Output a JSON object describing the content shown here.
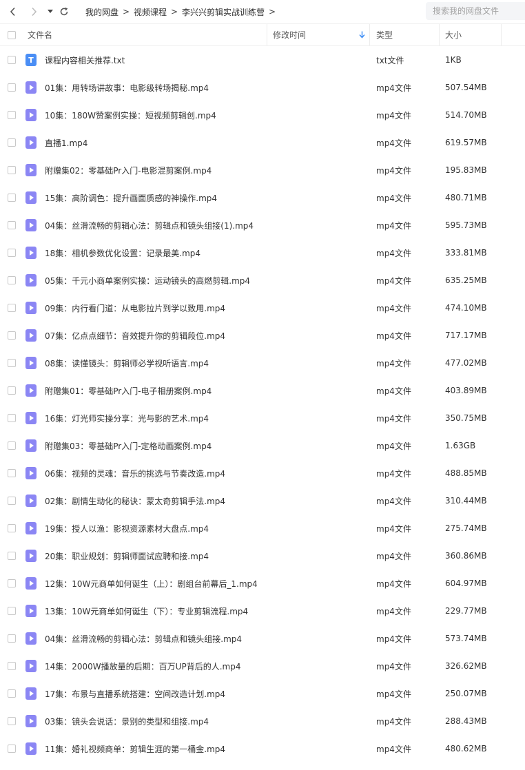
{
  "nav": {
    "breadcrumbs": [
      "我的网盘",
      "视频课程",
      "李兴兴剪辑实战训练营"
    ],
    "separator": ">"
  },
  "search": {
    "placeholder": "搜索我的网盘文件"
  },
  "columns": {
    "name": "文件名",
    "modified": "修改时间",
    "type": "类型",
    "size": "大小"
  },
  "colors": {
    "video_icon": "#8b86f4",
    "text_icon": "#4a8ef5",
    "sort_arrow": "#3b8cf5"
  },
  "files": [
    {
      "icon": "text-file-icon",
      "icon_letter": "T",
      "name": "课程内容相关推荐.txt",
      "type": "txt文件",
      "size": "1KB"
    },
    {
      "icon": "video-file-icon",
      "name": "01集：用转场讲故事：电影级转场揭秘.mp4",
      "type": "mp4文件",
      "size": "507.54MB"
    },
    {
      "icon": "video-file-icon",
      "name": "10集：180W赞案例实操：短视频剪辑创.mp4",
      "type": "mp4文件",
      "size": "514.70MB"
    },
    {
      "icon": "video-file-icon",
      "name": "直播1.mp4",
      "type": "mp4文件",
      "size": "619.57MB"
    },
    {
      "icon": "video-file-icon",
      "name": "附赠集02：零基础Pr入门-电影混剪案例.mp4",
      "type": "mp4文件",
      "size": "195.83MB"
    },
    {
      "icon": "video-file-icon",
      "name": "15集：高阶调色：提升画面质感的神操作.mp4",
      "type": "mp4文件",
      "size": "480.71MB"
    },
    {
      "icon": "video-file-icon",
      "name": "04集：丝滑流畅的剪辑心法：剪辑点和镜头组接(1).mp4",
      "type": "mp4文件",
      "size": "595.73MB"
    },
    {
      "icon": "video-file-icon",
      "name": "18集：相机参数优化设置：记录最美.mp4",
      "type": "mp4文件",
      "size": "333.81MB"
    },
    {
      "icon": "video-file-icon",
      "name": "05集：千元小商单案例实操：运动镜头的高燃剪辑.mp4",
      "type": "mp4文件",
      "size": "635.25MB"
    },
    {
      "icon": "video-file-icon",
      "name": "09集：内行看门道：从电影拉片到学以致用.mp4",
      "type": "mp4文件",
      "size": "474.10MB"
    },
    {
      "icon": "video-file-icon",
      "name": "07集：亿点点细节：音效提升你的剪辑段位.mp4",
      "type": "mp4文件",
      "size": "717.17MB"
    },
    {
      "icon": "video-file-icon",
      "name": "08集：读懂镜头：剪辑师必学视听语言.mp4",
      "type": "mp4文件",
      "size": "477.02MB"
    },
    {
      "icon": "video-file-icon",
      "name": "附赠集01：零基础Pr入门-电子相册案例.mp4",
      "type": "mp4文件",
      "size": "403.89MB"
    },
    {
      "icon": "video-file-icon",
      "name": "16集：灯光师实操分享：光与影的艺术.mp4",
      "type": "mp4文件",
      "size": "350.75MB"
    },
    {
      "icon": "video-file-icon",
      "name": "附赠集03：零基础Pr入门-定格动画案例.mp4",
      "type": "mp4文件",
      "size": "1.63GB"
    },
    {
      "icon": "video-file-icon",
      "name": "06集：视频的灵魂：音乐的挑选与节奏改造.mp4",
      "type": "mp4文件",
      "size": "488.85MB"
    },
    {
      "icon": "video-file-icon",
      "name": "02集：剧情生动化的秘诀：蒙太奇剪辑手法.mp4",
      "type": "mp4文件",
      "size": "310.44MB"
    },
    {
      "icon": "video-file-icon",
      "name": "19集：授人以渔：影视资源素材大盘点.mp4",
      "type": "mp4文件",
      "size": "275.74MB"
    },
    {
      "icon": "video-file-icon",
      "name": "20集：职业规划：剪辑师面试应聘和接.mp4",
      "type": "mp4文件",
      "size": "360.86MB"
    },
    {
      "icon": "video-file-icon",
      "name": "12集：10W元商单如何诞生（上）：剧组台前幕后_1.mp4",
      "type": "mp4文件",
      "size": "604.97MB"
    },
    {
      "icon": "video-file-icon",
      "name": "13集：10W元商单如何诞生（下）：专业剪辑流程.mp4",
      "type": "mp4文件",
      "size": "229.77MB"
    },
    {
      "icon": "video-file-icon",
      "name": "04集：丝滑流畅的剪辑心法：剪辑点和镜头组接.mp4",
      "type": "mp4文件",
      "size": "573.74MB"
    },
    {
      "icon": "video-file-icon",
      "name": "14集：2000W播放量的后期：百万UP背后的人.mp4",
      "type": "mp4文件",
      "size": "326.62MB"
    },
    {
      "icon": "video-file-icon",
      "name": "17集：布景与直播系统搭建：空间改造计划.mp4",
      "type": "mp4文件",
      "size": "250.07MB"
    },
    {
      "icon": "video-file-icon",
      "name": "03集：镜头会说话：景别的类型和组接.mp4",
      "type": "mp4文件",
      "size": "288.43MB"
    },
    {
      "icon": "video-file-icon",
      "name": "11集：婚礼视频商单：剪辑生涯的第一桶金.mp4",
      "type": "mp4文件",
      "size": "480.62MB"
    }
  ]
}
